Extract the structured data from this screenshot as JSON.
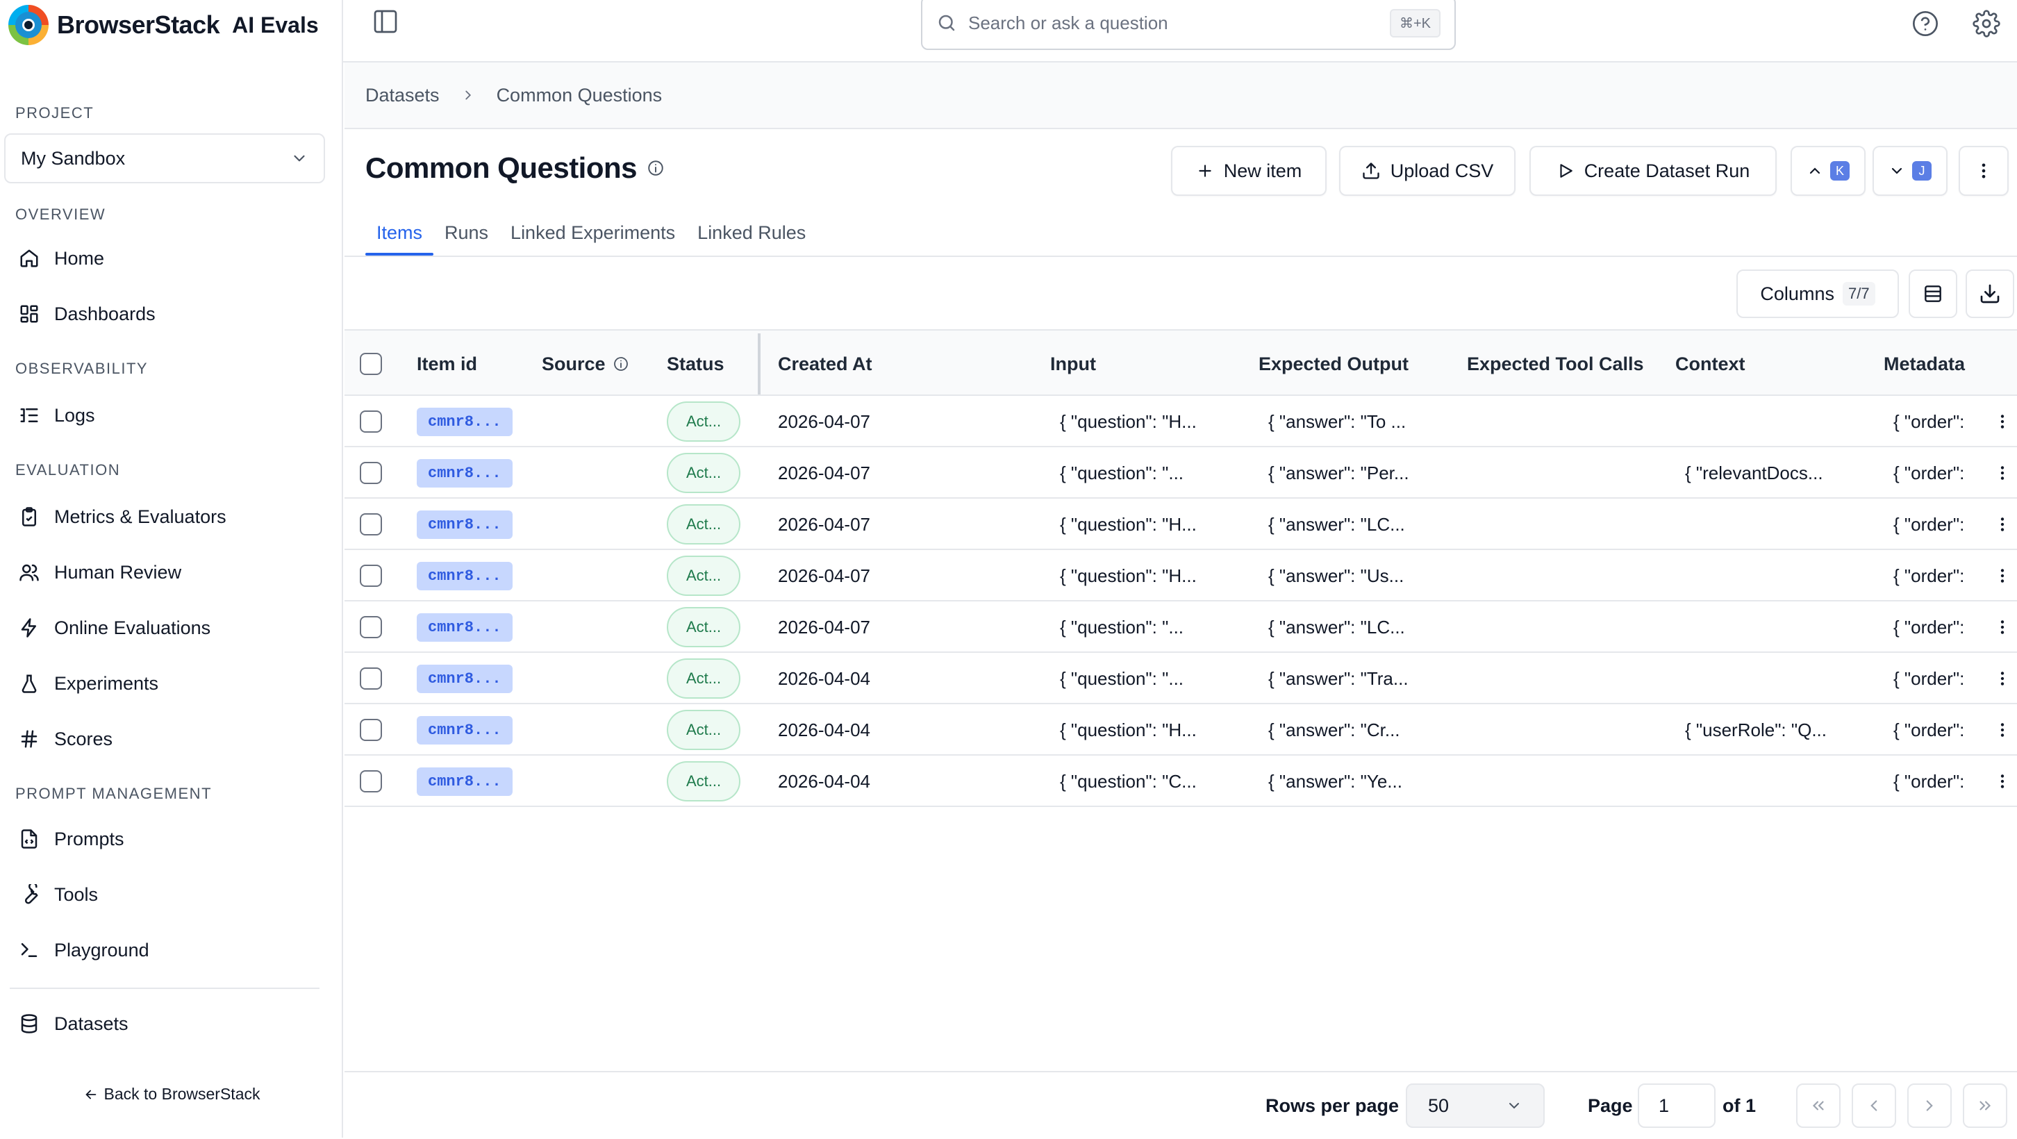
{
  "brand": {
    "name": "BrowserStack",
    "product": "AI Evals"
  },
  "sidebar": {
    "project_label": "PROJECT",
    "project_value": "My Sandbox",
    "sections": {
      "overview": "OVERVIEW",
      "observability": "OBSERVABILITY",
      "evaluation": "EVALUATION",
      "prompt_management": "PROMPT MANAGEMENT"
    },
    "items": {
      "home": "Home",
      "dashboards": "Dashboards",
      "logs": "Logs",
      "metrics": "Metrics & Evaluators",
      "human_review": "Human Review",
      "online_evaluations": "Online Evaluations",
      "experiments": "Experiments",
      "scores": "Scores",
      "prompts": "Prompts",
      "tools": "Tools",
      "playground": "Playground",
      "datasets": "Datasets"
    },
    "back_link": "Back to BrowserStack"
  },
  "header": {
    "search_placeholder": "Search or ask a question",
    "search_shortcut": "⌘+K"
  },
  "breadcrumb": {
    "root": "Datasets",
    "current": "Common Questions"
  },
  "page": {
    "title": "Common Questions",
    "actions": {
      "new_item": "New item",
      "upload_csv": "Upload CSV",
      "create_run": "Create Dataset Run",
      "prev_key": "K",
      "next_key": "J"
    },
    "tabs": [
      "Items",
      "Runs",
      "Linked Experiments",
      "Linked Rules"
    ],
    "active_tab": "Items",
    "columns_label": "Columns",
    "columns_count": "7/7"
  },
  "table": {
    "headers": {
      "item_id": "Item id",
      "source": "Source",
      "status": "Status",
      "created_at": "Created At",
      "input": "Input",
      "expected_output": "Expected Output",
      "expected_tool_calls": "Expected Tool Calls",
      "context": "Context",
      "metadata": "Metadata"
    },
    "rows": [
      {
        "id": "cmnr8...",
        "status": "Act...",
        "created": "2026-04-07",
        "input": "{ \"question\": \"H...",
        "output": "{ \"answer\": \"To ...",
        "context": "",
        "metadata": "{ \"order\":"
      },
      {
        "id": "cmnr8...",
        "status": "Act...",
        "created": "2026-04-07",
        "input": "{ \"question\": \"...",
        "output": "{ \"answer\": \"Per...",
        "context": "{ \"relevantDocs...",
        "metadata": "{ \"order\":"
      },
      {
        "id": "cmnr8...",
        "status": "Act...",
        "created": "2026-04-07",
        "input": "{ \"question\": \"H...",
        "output": "{ \"answer\": \"LC...",
        "context": "",
        "metadata": "{ \"order\":"
      },
      {
        "id": "cmnr8...",
        "status": "Act...",
        "created": "2026-04-07",
        "input": "{ \"question\": \"H...",
        "output": "{ \"answer\": \"Us...",
        "context": "",
        "metadata": "{ \"order\":"
      },
      {
        "id": "cmnr8...",
        "status": "Act...",
        "created": "2026-04-07",
        "input": "{ \"question\": \"...",
        "output": "{ \"answer\": \"LC...",
        "context": "",
        "metadata": "{ \"order\":"
      },
      {
        "id": "cmnr8...",
        "status": "Act...",
        "created": "2026-04-04",
        "input": "{ \"question\": \"...",
        "output": "{ \"answer\": \"Tra...",
        "context": "",
        "metadata": "{ \"order\":"
      },
      {
        "id": "cmnr8...",
        "status": "Act...",
        "created": "2026-04-04",
        "input": "{ \"question\": \"H...",
        "output": "{ \"answer\": \"Cr...",
        "context": "{ \"userRole\": \"Q...",
        "metadata": "{ \"order\":"
      },
      {
        "id": "cmnr8...",
        "status": "Act...",
        "created": "2026-04-04",
        "input": "{ \"question\": \"C...",
        "output": "{ \"answer\": \"Ye...",
        "context": "",
        "metadata": "{ \"order\":"
      }
    ]
  },
  "pagination": {
    "rows_per_page_label": "Rows per page",
    "rows_per_page": "50",
    "page_label": "Page",
    "page": "1",
    "of_label": "of 1"
  },
  "colors": {
    "accent": "#2563eb",
    "badge_bg": "#c7d7fe",
    "status_bg": "#eefaf3"
  }
}
